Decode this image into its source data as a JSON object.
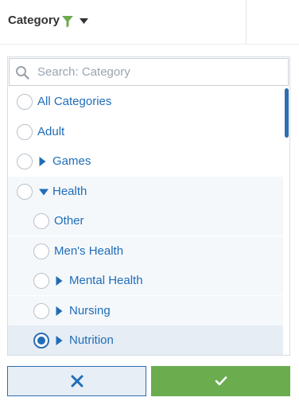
{
  "header": {
    "title": "Category"
  },
  "search": {
    "placeholder": "Search: Category",
    "value": ""
  },
  "items": [
    {
      "label": "All Categories",
      "level": 0,
      "expander": "none",
      "selected": false
    },
    {
      "label": "Adult",
      "level": 0,
      "expander": "none",
      "selected": false
    },
    {
      "label": "Games",
      "level": 0,
      "expander": "collapsed",
      "selected": false
    },
    {
      "label": "Health",
      "level": 0,
      "expander": "expanded",
      "selected": false
    },
    {
      "label": "Other",
      "level": 1,
      "expander": "none",
      "selected": false
    },
    {
      "label": "Men's Health",
      "level": 1,
      "expander": "none",
      "selected": false
    },
    {
      "label": "Mental Health",
      "level": 1,
      "expander": "collapsed",
      "selected": false
    },
    {
      "label": "Nursing",
      "level": 1,
      "expander": "collapsed",
      "selected": false
    },
    {
      "label": "Nutrition",
      "level": 1,
      "expander": "collapsed",
      "selected": true
    }
  ],
  "buttons": {
    "cancel_icon": "close-icon",
    "apply_icon": "check-icon"
  },
  "colors": {
    "accent": "#1f6db8",
    "filter_icon": "#6aac4e",
    "apply_button": "#6aac4e",
    "cancel_button_bg": "#e7eef5"
  }
}
